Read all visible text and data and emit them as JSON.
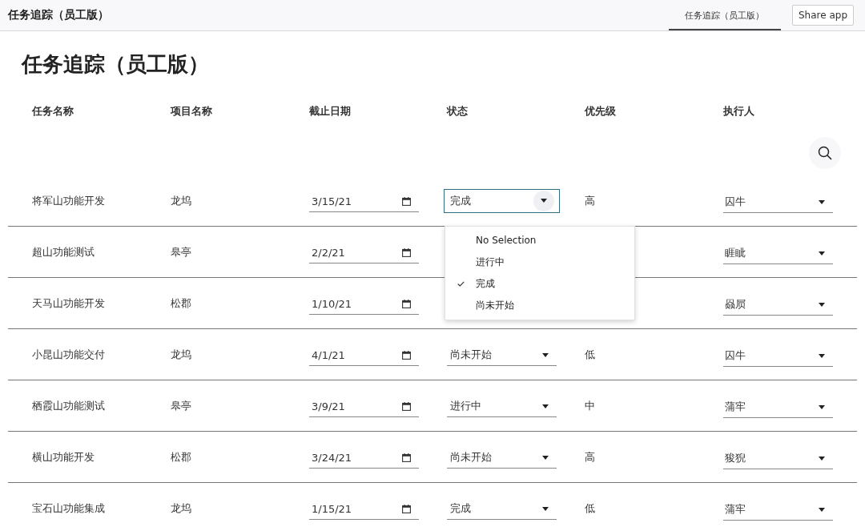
{
  "app_bar": {
    "title": "任务追踪（员工版）",
    "tabs": [
      {
        "label": "任务追踪（员工版）",
        "selected": true
      }
    ],
    "share_button": "Share app"
  },
  "page_title": "任务追踪（员工版）",
  "table": {
    "columns": [
      "任务名称",
      "项目名称",
      "截止日期",
      "状态",
      "优先级",
      "执行人"
    ],
    "rows": [
      {
        "task": "将军山功能开发",
        "project": "龙坞",
        "due": "3/15/21",
        "status": "完成",
        "status_open": true,
        "priority": "高",
        "assignee": "囚牛"
      },
      {
        "task": "超山功能测试",
        "project": "皋亭",
        "due": "2/2/21",
        "assignee": "睚眦"
      },
      {
        "task": "天马山功能开发",
        "project": "松郡",
        "due": "1/10/21",
        "assignee": "赑屃"
      },
      {
        "task": "小昆山功能交付",
        "project": "龙坞",
        "due": "4/1/21",
        "status": "尚未开始",
        "status_open": false,
        "priority": "低",
        "assignee": "囚牛"
      },
      {
        "task": "栖霞山功能测试",
        "project": "皋亭",
        "due": "3/9/21",
        "status": "进行中",
        "status_open": false,
        "priority": "中",
        "assignee": "蒲牢"
      },
      {
        "task": "横山功能开发",
        "project": "松郡",
        "due": "3/24/21",
        "status": "尚未开始",
        "status_open": false,
        "priority": "高",
        "assignee": "狻猊"
      },
      {
        "task": "宝石山功能集成",
        "project": "龙坞",
        "due": "1/15/21",
        "status": "完成",
        "status_open": false,
        "priority": "低",
        "assignee": "蒲牢"
      }
    ],
    "status_menu": [
      {
        "label": "No Selection",
        "selected": false
      },
      {
        "label": "进行中",
        "selected": false
      },
      {
        "label": "完成",
        "selected": true
      },
      {
        "label": "尚未开始",
        "selected": false
      }
    ]
  }
}
